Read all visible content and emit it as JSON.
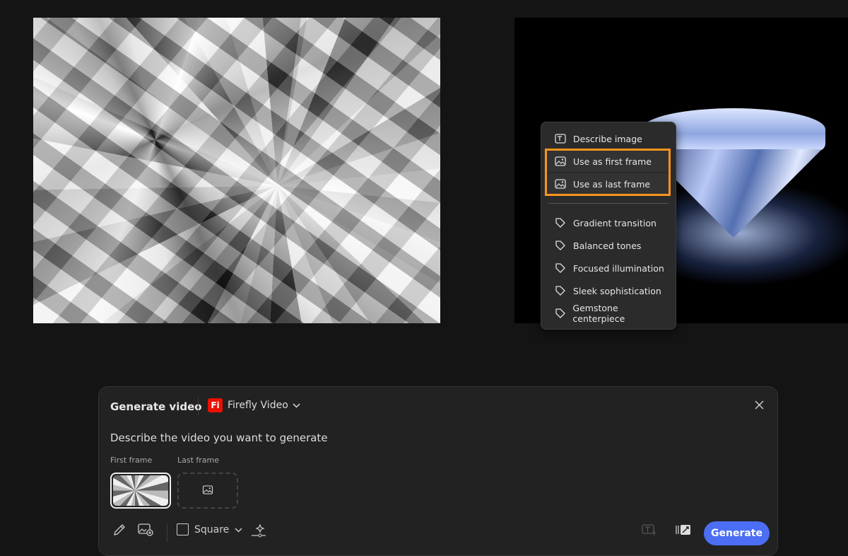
{
  "context_menu": {
    "actions": [
      {
        "label": "Describe image",
        "icon": "describe-text-icon"
      },
      {
        "label": "Use as first frame",
        "icon": "image-icon"
      },
      {
        "label": "Use as last frame",
        "icon": "image-icon"
      }
    ],
    "tags": [
      "Gradient transition",
      "Balanced tones",
      "Focused illumination",
      "Sleek sophistication",
      "Gemstone centerpiece"
    ],
    "highlight_color": "#f7941d"
  },
  "panel": {
    "title": "Generate video",
    "model_badge": "Fi",
    "model": "Firefly Video",
    "prompt_placeholder": "Describe the video you want to generate",
    "first_frame_label": "First frame",
    "last_frame_label": "Last frame",
    "aspect": "Square",
    "generate_label": "Generate",
    "accent": "#4b6ef5"
  }
}
